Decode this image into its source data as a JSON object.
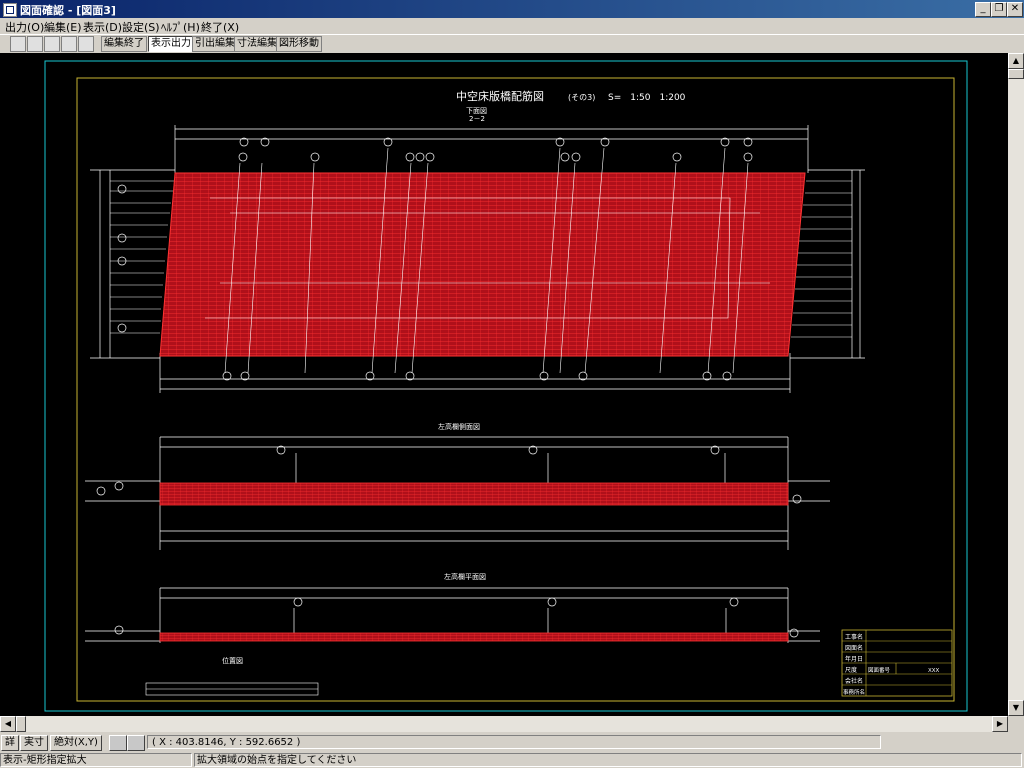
{
  "window": {
    "title": "図面確認 - [図面3]"
  },
  "menu": [
    "出力(O)",
    "編集(E)",
    "表示(D)",
    "設定(S)",
    "ﾍﾙﾌﾟ(H)",
    "終了(X)"
  ],
  "toolbar": {
    "end_edit": "編集終了",
    "display_output": "表示出力",
    "leader_edit": "引出編集",
    "dimension_edit": "寸法編集",
    "figure_move": "図形移動"
  },
  "drawing": {
    "title": "中空床版橋配筋図",
    "title_part": "(その3)",
    "scale": "S=　1:50　1:200",
    "section1_label": "下面図",
    "section1_sub": "2－2",
    "section2_label": "左高欄側面図",
    "section3_label": "左高欄平面図",
    "location_label": "位置図",
    "title_block": [
      "工事名",
      "図面名",
      "年月日",
      "尺度",
      "会社名",
      "事務所名"
    ],
    "drawing_number_label": "図面番号",
    "drawing_number_value": "XXX"
  },
  "status": {
    "detail": "詳",
    "actual": "実寸",
    "absolute": "絶対(X,Y)",
    "coordinates": "( X : 403.8146, Y : 592.6652 )",
    "mode": "表示-矩形指定拡大",
    "message": "拡大領域の始点を指定してください"
  },
  "colors": {
    "rebar": "#e8191e",
    "frame_cyan": "#19c8d2",
    "frame_yellow": "#c8b432",
    "line": "#ffffff"
  }
}
